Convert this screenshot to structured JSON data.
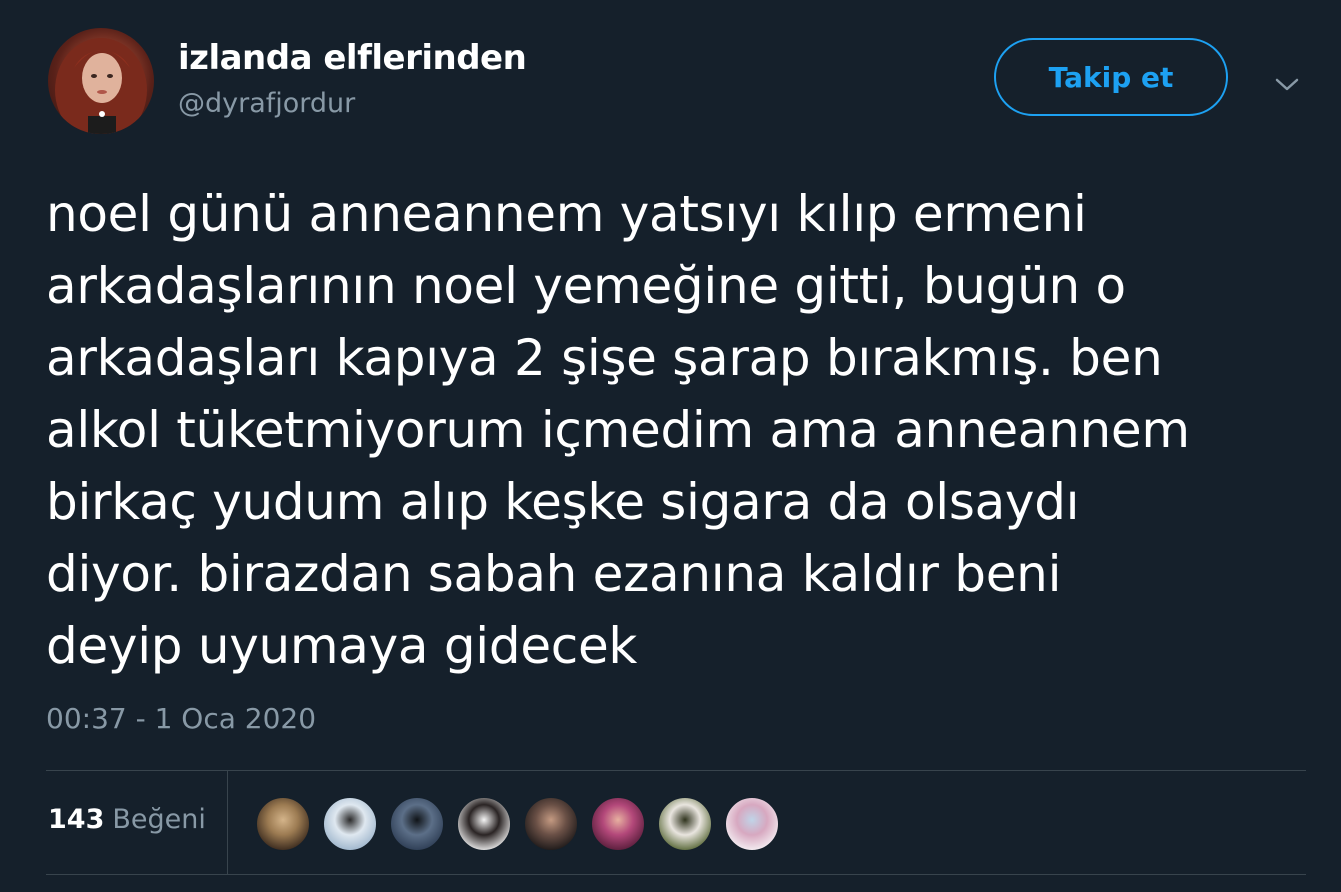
{
  "user": {
    "display_name": "izlanda elflerinden",
    "handle": "@dyrafjordur"
  },
  "actions": {
    "follow_label": "Takip et"
  },
  "tweet": {
    "text": "noel günü anneannem yatsıyı kılıp ermeni\narkadaşlarının noel yemeğine gitti, bugün o\narkadaşları kapıya 2 şişe şarap bırakmış. ben\nalkol tüketmiyorum içmedim ama anneannem\nbirkaç yudum alıp keşke sigara da olsaydı\ndiyor. birazdan sabah ezanına kaldır beni\ndeyip uyumaya gidecek",
    "timestamp": "00:37 - 1 Oca 2020"
  },
  "stats": {
    "likes_count": "143",
    "likes_label": "Beğeni"
  },
  "colors": {
    "background": "#15202b",
    "accent": "#1da1f2",
    "secondary_text": "#8899a6",
    "divider": "#38444d"
  },
  "likers": [
    {
      "colors": [
        "#3a2a1e",
        "#9c7b52",
        "#d4b48a"
      ]
    },
    {
      "colors": [
        "#9fb6cc",
        "#dfe8f0",
        "#2b2b2b"
      ]
    },
    {
      "colors": [
        "#2e3e55",
        "#5c6f88",
        "#101418"
      ]
    },
    {
      "colors": [
        "#e8e8e8",
        "#2a2424",
        "#f5f5f5"
      ]
    },
    {
      "colors": [
        "#1e1a1a",
        "#6a5046",
        "#c49a82"
      ]
    },
    {
      "colors": [
        "#5a1e3c",
        "#b3487a",
        "#e7b0a0"
      ]
    },
    {
      "colors": [
        "#5b6a3a",
        "#e9e5df",
        "#30341e"
      ]
    },
    {
      "colors": [
        "#f4eef2",
        "#d7a8c0",
        "#c0d4e8"
      ]
    }
  ]
}
